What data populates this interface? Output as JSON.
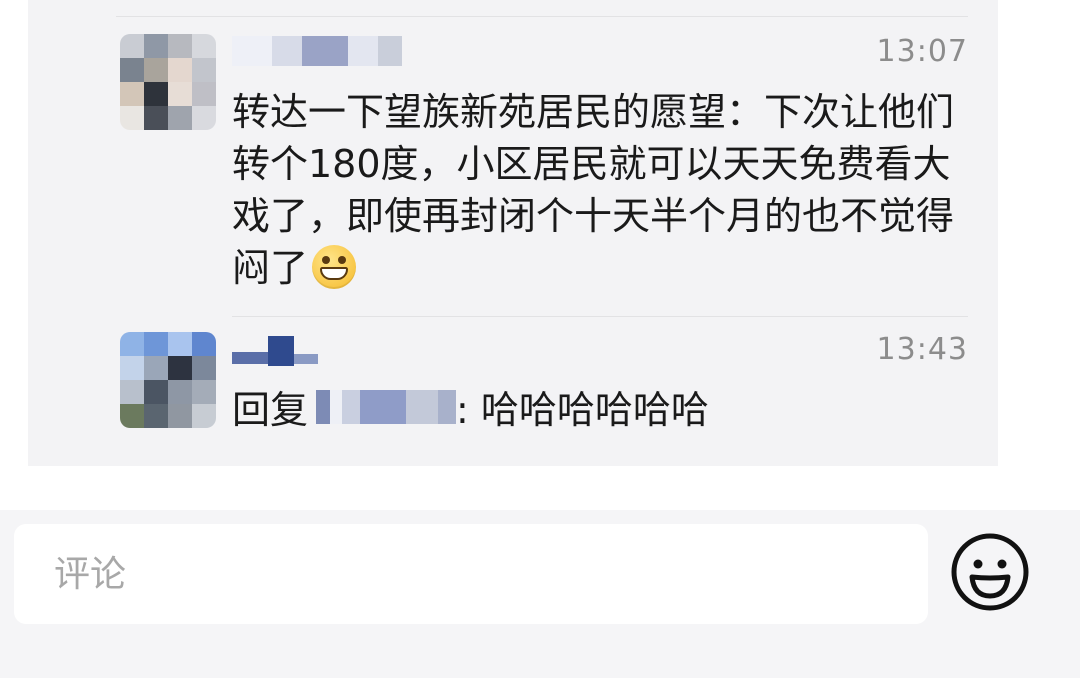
{
  "comments": [
    {
      "time": "13:07",
      "text": "转达一下望族新苑居民的愿望：下次让他们转个180度，小区居民就可以天天免费看大戏了，即使再封闭个十天半个月的也不觉得闷了",
      "emoji_icon": "grinning-face-icon",
      "username_obscured": true
    },
    {
      "time": "13:43",
      "reply_prefix": "回复",
      "reply_suffix": ": 哈哈哈哈哈哈",
      "username_obscured": true
    }
  ],
  "composer": {
    "placeholder": "评论",
    "value": "",
    "emoji_button_icon": "smiley-face-icon"
  },
  "colors": {
    "panel_background": "#f3f3f5",
    "timestamp": "#8c8c8c",
    "text": "#1a1a1a",
    "placeholder": "#a8a8a8"
  }
}
